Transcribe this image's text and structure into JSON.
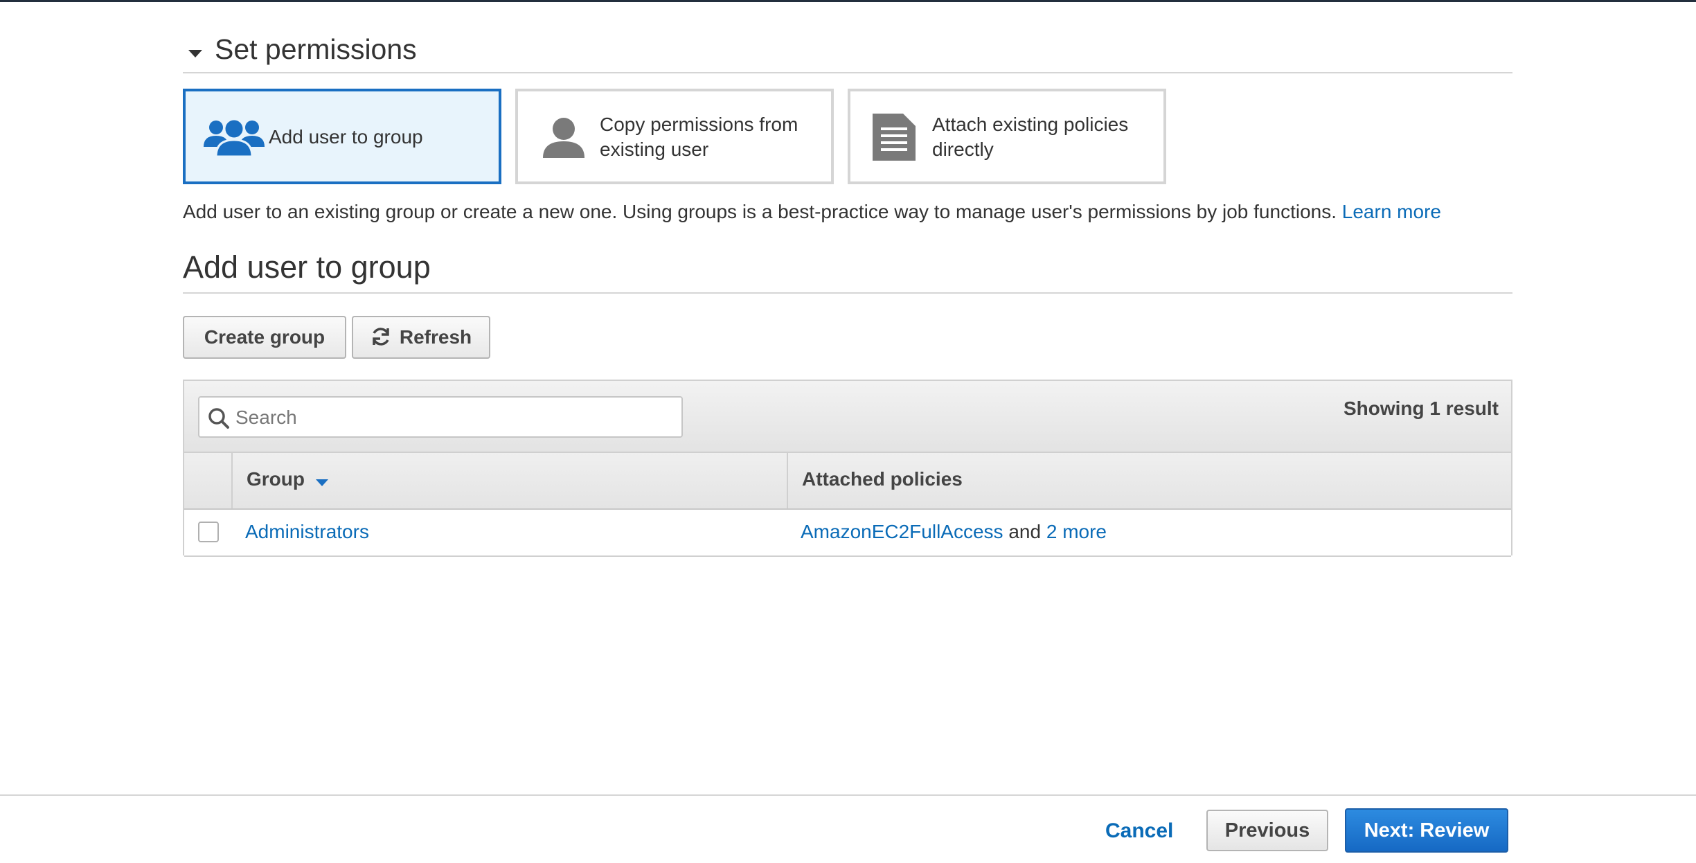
{
  "colors": {
    "accent": "#1a6fc2",
    "link": "#0a6bb7",
    "selected_tile_bg": "#e8f4fc",
    "primary_button": "#1669c4"
  },
  "section": {
    "title": "Set permissions"
  },
  "options": [
    {
      "label": "Add user to group",
      "icon": "users-group-icon",
      "selected": true
    },
    {
      "label_line1": "Copy permissions from",
      "label_line2": "existing user",
      "icon": "user-icon",
      "selected": false
    },
    {
      "label_line1": "Attach existing policies",
      "label_line2": "directly",
      "icon": "document-icon",
      "selected": false
    }
  ],
  "description": {
    "text": "Add user to an existing group or create a new one. Using groups is a best-practice way to manage user's permissions by job functions.",
    "link": "Learn more"
  },
  "group_section": {
    "title": "Add user to group",
    "create_button": "Create group",
    "refresh_button": "Refresh"
  },
  "table": {
    "search_placeholder": "Search",
    "result_count": "Showing 1 result",
    "columns": [
      "Group",
      "Attached policies"
    ],
    "rows": [
      {
        "group": "Administrators",
        "policy": "AmazonEC2FullAccess",
        "policy_joiner": "and",
        "more_link": "2 more",
        "checked": false
      }
    ]
  },
  "footer": {
    "cancel": "Cancel",
    "previous": "Previous",
    "next": "Next: Review"
  }
}
